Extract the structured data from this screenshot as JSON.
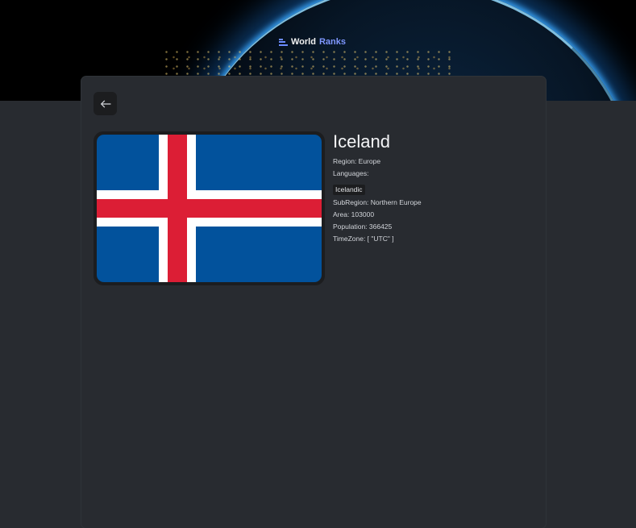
{
  "header": {
    "logo_word1": "World",
    "logo_word2": "Ranks",
    "logo_icon": "bars-icon"
  },
  "navigation": {
    "back_icon": "arrow-left-icon"
  },
  "country": {
    "name": "Iceland",
    "flag_icon": "iceland-flag",
    "region": "Region: Europe",
    "languages_label": "Languages:",
    "languages": [
      "Icelandic"
    ],
    "subregion": "SubRegion: Northern Europe",
    "area": "Area: 103000",
    "population": "Population: 366425",
    "timezone": "TimeZone: [ \"UTC\" ]"
  },
  "colors": {
    "background": "#282B30",
    "header_bg": "#000000",
    "accent": "#7F97FF",
    "chip_bg": "#1C1D1F",
    "flag_blue": "#02529C",
    "flag_red": "#DC1E35",
    "flag_white": "#FFFFFF"
  }
}
